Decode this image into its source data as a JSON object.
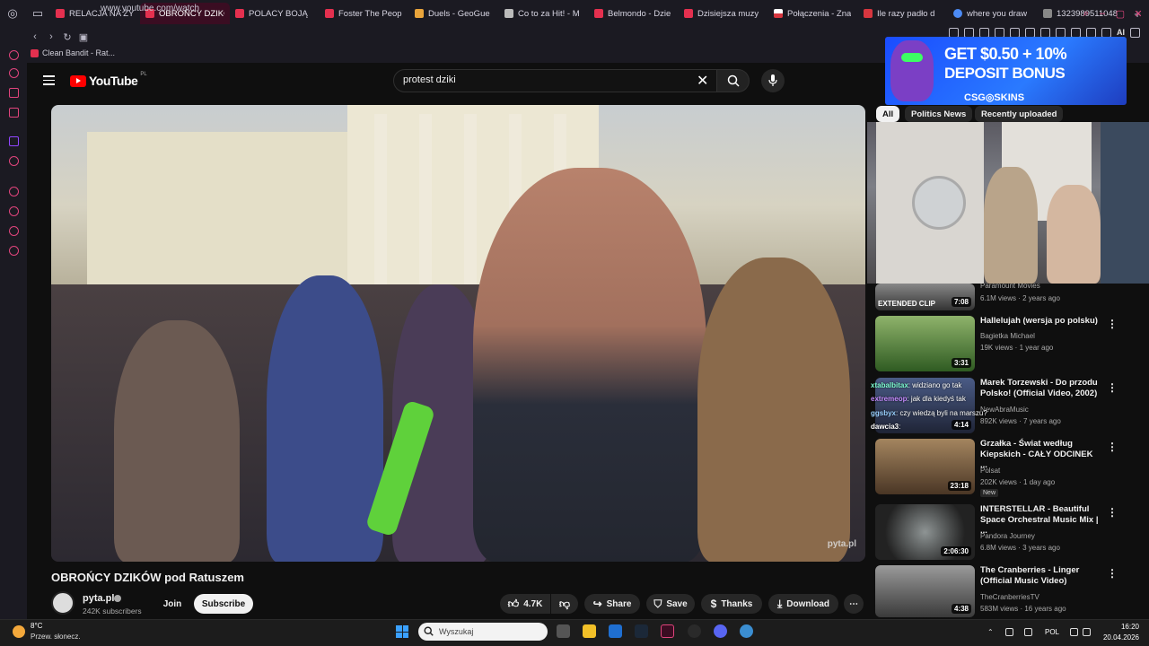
{
  "browser": {
    "tabs": [
      {
        "label": "RELACJA NA ŻY",
        "color": "#e4304f"
      },
      {
        "label": "OBROŃCY DZIKÓW po",
        "color": "#e4304f",
        "active": true
      },
      {
        "label": "POLACY BOJĄ",
        "color": "#e4304f"
      },
      {
        "label": "Foster The Peop",
        "color": "#e4304f"
      },
      {
        "label": "Duels - GeoGue",
        "color": "#e9a43b"
      },
      {
        "label": "Co to za Hit! - M",
        "color": "#bbbbbb"
      },
      {
        "label": "Belmondo - Dzie",
        "color": "#e4304f"
      },
      {
        "label": "Dzisiejsza muzy",
        "color": "#e4304f"
      },
      {
        "label": "Połączenia - Zna",
        "color": "#ffffff"
      },
      {
        "label": "Ile razy padło d",
        "color": "#d7363f"
      },
      {
        "label": "where you draw",
        "color": "#4c8bf5"
      },
      {
        "label": "1323989511048",
        "color": "#888888"
      }
    ],
    "url": "www.youtube.com/watch",
    "bookmark": "Clean Bandit - Rat...",
    "ai_label": "AI"
  },
  "youtube": {
    "logo_text": "YouTube",
    "country_code": "PL",
    "search_value": "protest dziki",
    "video_title": "OBROŃCY DZIKÓW pod Ratuszem",
    "watermark": "pyta.pl",
    "channel": {
      "name": "pyta.pl",
      "subscribers": "242K subscribers"
    },
    "buttons": {
      "join": "Join",
      "subscribe": "Subscribe",
      "likes": "4.7K",
      "share": "Share",
      "save": "Save",
      "thanks": "Thanks",
      "download": "Download"
    },
    "ad": {
      "line1": "GET $0.50 + 10%",
      "line2": "DEPOSIT BONUS",
      "brand": "CSG◎SKINS"
    },
    "chips": [
      "All",
      "Politics News",
      "Recently uploaded"
    ],
    "partial_rec": {
      "channel": "Paramount Movies",
      "meta": "6.1M views · 2 years ago",
      "overlay": "EXTENDED CLIP",
      "duration": "7:08"
    },
    "recommendations": [
      {
        "title": "Hallelujah (wersja po polsku)",
        "channel": "Bagietka Michael",
        "meta": "19K views · 1 year ago",
        "duration": "3:31",
        "thumb": "#3d6a2a"
      },
      {
        "title": "Marek Torzewski - Do przodu Polsko! (Official Video, 2002)",
        "channel": "NewAbraMusic",
        "meta": "892K views · 7 years ago",
        "duration": "4:14",
        "thumb": "#3a3f63"
      },
      {
        "title": "Grzałka - Świat według Kiepskich - CAŁY ODCINEK ...",
        "channel": "Polsat",
        "meta": "202K views · 1 day ago",
        "duration": "23:18",
        "badge": "New",
        "thumb": "#8a6a4a"
      },
      {
        "title": "INTERSTELLAR - Beautiful Space Orchestral Music Mix | ...",
        "channel": "Pandora Journey",
        "meta": "6.8M views · 3 years ago",
        "duration": "2:06:30",
        "thumb": "#5b5e5e"
      },
      {
        "title": "The Cranberries - Linger (Official Music Video)",
        "channel": "TheCranberriesTV",
        "meta": "583M views · 16 years ago",
        "duration": "4:38",
        "thumb": "#6a6a6a"
      }
    ],
    "chat": [
      {
        "user": "xtabalbitax",
        "text": ": widziano go tak"
      },
      {
        "user": "extremeop",
        "text": ": jak dla kiedyś tak"
      },
      {
        "user": "ggsbyx",
        "text": ": czy wiedzą byli na marszu?"
      },
      {
        "user": "dawcia3",
        "text": ":"
      }
    ]
  },
  "taskbar": {
    "temperature": "8°C",
    "weather": "Przew. słonecz.",
    "search_placeholder": "Wyszukaj",
    "language": "POL",
    "time": "16:20",
    "date": "20.04.2026"
  },
  "colors": {
    "accent": "#e0447c",
    "youtube_red": "#ff0000",
    "ad_blue": "#1a4cff"
  }
}
